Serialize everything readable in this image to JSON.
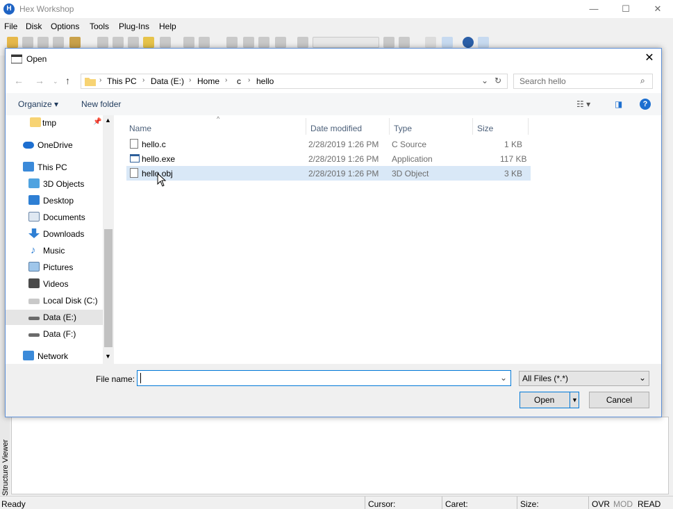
{
  "app": {
    "title": "Hex Workshop",
    "icon_letter": "H",
    "window_buttons": {
      "minimize": "—",
      "maximize": "☐",
      "close": "✕"
    }
  },
  "menu": [
    "File",
    "Disk",
    "Options",
    "Tools",
    "Plug-Ins",
    "Help"
  ],
  "structure_viewer_label": "Structure Viewer",
  "status": {
    "ready": "Ready",
    "cursor": "Cursor:",
    "caret": "Caret:",
    "size": "Size:",
    "ovr": "OVR",
    "mod": "MOD",
    "read": "READ"
  },
  "dialog": {
    "title": "Open",
    "close": "✕",
    "breadcrumb": [
      "This PC",
      "Data (E:)",
      "Home",
      "c",
      "hello"
    ],
    "search_placeholder": "Search hello",
    "organize_label": "Organize ▾",
    "new_folder_label": "New folder",
    "help_label": "?",
    "nav_items": [
      {
        "label": "tmp",
        "icon": "folder-icon"
      },
      {
        "label": "OneDrive",
        "icon": "cloud-icon"
      },
      {
        "label": "This PC",
        "icon": "computer-icon"
      },
      {
        "label": "3D Objects",
        "icon": "cube-icon"
      },
      {
        "label": "Desktop",
        "icon": "desktop-icon"
      },
      {
        "label": "Documents",
        "icon": "document-icon"
      },
      {
        "label": "Downloads",
        "icon": "download-icon"
      },
      {
        "label": "Music",
        "icon": "music-icon"
      },
      {
        "label": "Pictures",
        "icon": "picture-icon"
      },
      {
        "label": "Videos",
        "icon": "video-icon"
      },
      {
        "label": "Local Disk (C:)",
        "icon": "drive-icon"
      },
      {
        "label": "Data (E:)",
        "icon": "drive-icon"
      },
      {
        "label": "Data (F:)",
        "icon": "drive-icon"
      },
      {
        "label": "Network",
        "icon": "network-icon"
      }
    ],
    "columns": [
      "Name",
      "Date modified",
      "Type",
      "Size"
    ],
    "files": [
      {
        "name": "hello.c",
        "date": "2/28/2019 1:26 PM",
        "type": "C Source",
        "size": "1 KB"
      },
      {
        "name": "hello.exe",
        "date": "2/28/2019 1:26 PM",
        "type": "Application",
        "size": "117 KB"
      },
      {
        "name": "hello.obj",
        "date": "2/28/2019 1:26 PM",
        "type": "3D Object",
        "size": "3 KB"
      }
    ],
    "file_name_label": "File name:",
    "file_name_value": "",
    "filter_value": "All Files (*.*)",
    "open_label": "Open",
    "cancel_label": "Cancel"
  }
}
